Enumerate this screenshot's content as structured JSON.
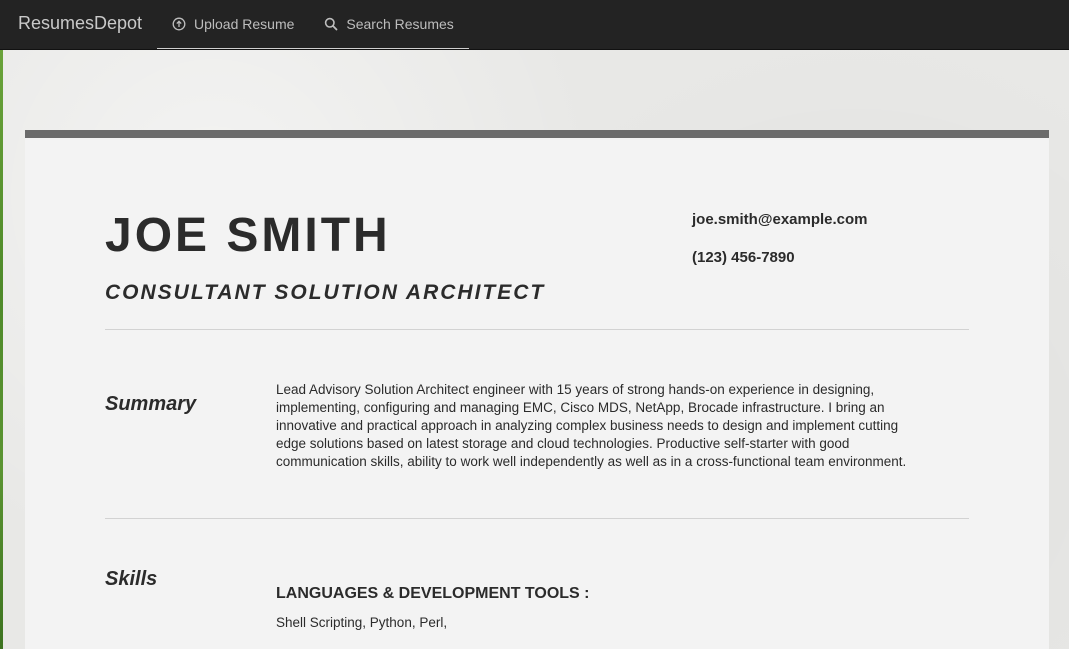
{
  "navbar": {
    "brand": "ResumesDepot",
    "items": [
      {
        "label": "Upload Resume",
        "icon": "upload-circle-icon"
      },
      {
        "label": "Search Resumes",
        "icon": "search-icon"
      }
    ]
  },
  "resume": {
    "name": "JOE SMITH",
    "title": "CONSULTANT SOLUTION ARCHITECT",
    "email": "joe.smith@example.com",
    "phone": "(123) 456-7890",
    "summary": {
      "label": "Summary",
      "text": "Lead Advisory Solution Architect engineer with 15 years of strong hands-on experience in designing, implementing, configuring and managing EMC, Cisco MDS, NetApp, Brocade infrastructure. I bring an innovative and practical approach in analyzing complex business needs to design and implement cutting edge solutions based on latest storage and cloud technologies. Productive self-starter with good communication skills, ability to work well independently as well as in a cross-functional team environment."
    },
    "skills": {
      "label": "Skills",
      "groups": [
        {
          "heading": "LANGUAGES & DEVELOPMENT TOOLS :",
          "items": "Shell Scripting, Python, Perl,"
        }
      ]
    }
  },
  "colors": {
    "navbar_bg": "#232323",
    "card_bg": "#f3f3f3",
    "card_top_border": "#6b6b6b",
    "text": "#2b2b2b"
  }
}
